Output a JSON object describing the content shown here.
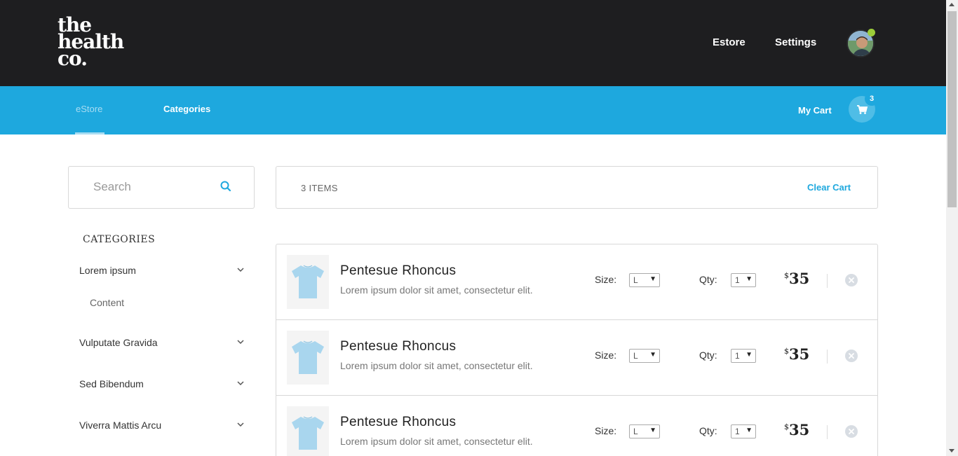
{
  "brand": {
    "logo_lines": [
      "the",
      "health",
      "co."
    ]
  },
  "top_nav": {
    "estore": "Estore",
    "settings": "Settings"
  },
  "sub_nav": {
    "tabs": [
      {
        "label": "eStore"
      },
      {
        "label": "Categories"
      }
    ],
    "my_cart": "My Cart",
    "cart_count": "3"
  },
  "search": {
    "placeholder": "Search"
  },
  "categories": {
    "title": "CATEGORIES",
    "items": [
      {
        "label": "Lorem ipsum",
        "sub": "Content"
      },
      {
        "label": "Vulputate Gravida"
      },
      {
        "label": "Sed Bibendum"
      },
      {
        "label": "Viverra Mattis Arcu"
      }
    ]
  },
  "cart_summary": {
    "items_label": "3 ITEMS",
    "clear_label": "Clear Cart"
  },
  "cart_items": [
    {
      "name": "Pentesue Rhoncus",
      "desc": "Lorem ipsum dolor sit amet, consectetur elit.",
      "size_label": "Size:",
      "size": "L",
      "qty_label": "Qty:",
      "qty": "1",
      "currency": "$",
      "price": "35"
    },
    {
      "name": "Pentesue Rhoncus",
      "desc": "Lorem ipsum dolor sit amet, consectetur elit.",
      "size_label": "Size:",
      "size": "L",
      "qty_label": "Qty:",
      "qty": "1",
      "currency": "$",
      "price": "35"
    },
    {
      "name": "Pentesue Rhoncus",
      "desc": "Lorem ipsum dolor sit amet, consectetur elit.",
      "size_label": "Size:",
      "size": "L",
      "qty_label": "Qty:",
      "qty": "1",
      "currency": "$",
      "price": "35"
    }
  ],
  "colors": {
    "header_dark": "#1e1e20",
    "accent_blue": "#1ea8de",
    "status_green": "#9ccd3a"
  },
  "icons": {
    "search": "search-icon",
    "cart": "cart-icon",
    "chevron": "chevron-down-icon",
    "remove": "close-icon",
    "product": "tshirt-icon"
  }
}
